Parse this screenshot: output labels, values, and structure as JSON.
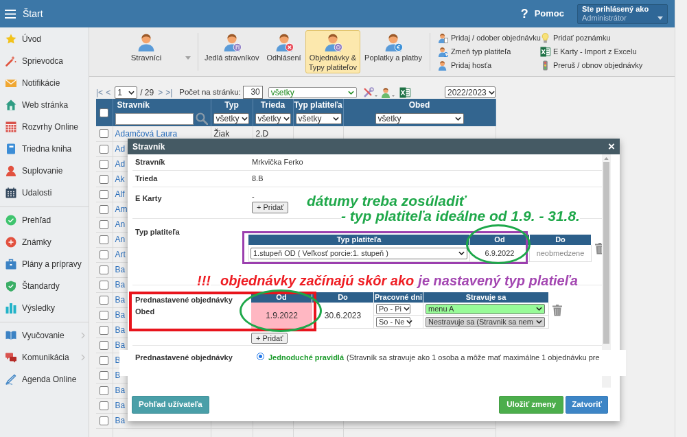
{
  "topbar": {
    "title": "Štart",
    "help_icon": "?",
    "help": "Pomoc",
    "user_label": "Ste prihlásený ako",
    "user_role": "Administrátor"
  },
  "sidebar": {
    "groups": [
      [
        {
          "label": "Úvod",
          "submenu": false
        },
        {
          "label": "Sprievodca",
          "submenu": false
        },
        {
          "label": "Notifikácie",
          "submenu": false
        },
        {
          "label": "Web stránka",
          "submenu": false
        },
        {
          "label": "Rozvrhy Online",
          "submenu": false
        },
        {
          "label": "Triedna kniha",
          "submenu": false
        },
        {
          "label": "Suplovanie",
          "submenu": false
        },
        {
          "label": "Udalosti",
          "submenu": false
        }
      ],
      [
        {
          "label": "Prehľad",
          "submenu": false
        },
        {
          "label": "Známky",
          "submenu": false
        },
        {
          "label": "Plány a prípravy",
          "submenu": false
        },
        {
          "label": "Štandardy",
          "submenu": false
        },
        {
          "label": "Výsledky",
          "submenu": false
        }
      ],
      [
        {
          "label": "Vyučovanie",
          "submenu": true
        },
        {
          "label": "Komunikácia",
          "submenu": true
        },
        {
          "label": "Agenda Online",
          "submenu": false
        }
      ]
    ]
  },
  "toolbar": {
    "menu": {
      "label": "Stravníci"
    },
    "buttons": [
      {
        "label": "Jedlá stravníkov",
        "selected": false
      },
      {
        "label": "Odhlásení",
        "selected": false
      },
      {
        "label": "Objednávky &\nTypy platiteľov",
        "selected": true
      },
      {
        "label": "Poplatky a platby",
        "selected": false
      }
    ],
    "links": [
      [
        "Pridaj / odober objednávku",
        "Zmeň typ platiteľa",
        "Pridaj hosťa"
      ],
      [
        "Pridať poznámku",
        "E Karty - Import z Excelu",
        "Preruš / obnov objednávky"
      ]
    ]
  },
  "pager": {
    "first": "|<",
    "prev": "<",
    "page": "1",
    "total": "/ 29",
    "next": ">",
    "last": ">|",
    "per_page_label": "Počet na stránku:",
    "per_page": "30",
    "filter": "všetky",
    "year": "2022/2023"
  },
  "table": {
    "select_all": {
      "checked": false
    },
    "columns": [
      "Stravník",
      "Typ",
      "Trieda",
      "Typ platiteľa",
      "Obed"
    ],
    "filters": [
      {
        "kind": "search"
      },
      {
        "kind": "select",
        "value": "všetky"
      },
      {
        "kind": "select",
        "value": "všetky"
      },
      {
        "kind": "select",
        "value": "všetky"
      },
      {
        "kind": "select",
        "value": "všetky"
      }
    ],
    "rows": [
      {
        "checked": false,
        "name": "Adamčová Laura",
        "type": "Žiak",
        "class": "2.D"
      },
      {
        "checked": false,
        "name": "Ad"
      },
      {
        "checked": false,
        "name": "Ad"
      },
      {
        "checked": false,
        "name": "Ak"
      },
      {
        "checked": false,
        "name": "Alf"
      },
      {
        "checked": false,
        "name": "Am"
      },
      {
        "checked": false,
        "name": "An"
      },
      {
        "checked": false,
        "name": "An"
      },
      {
        "checked": false,
        "name": "Art"
      },
      {
        "checked": false,
        "name": "Ba"
      },
      {
        "checked": false,
        "name": "Ba"
      },
      {
        "checked": false,
        "name": "Ba"
      },
      {
        "checked": false,
        "name": "Ba"
      },
      {
        "checked": false,
        "name": "Ba"
      },
      {
        "checked": false,
        "name": "Ba"
      },
      {
        "checked": false,
        "name": "B"
      },
      {
        "checked": false,
        "name": "B"
      },
      {
        "checked": false,
        "name": "Ba"
      },
      {
        "checked": false,
        "name": "Ba"
      },
      {
        "checked": false,
        "name": "Ba"
      }
    ]
  },
  "dialog": {
    "title": "Stravník",
    "close": "×",
    "fields": [
      {
        "label": "Stravník",
        "value": "Mrkvička Ferko"
      },
      {
        "label": "Trieda",
        "value": "8.B"
      }
    ],
    "cards": {
      "label": "E Karty",
      "value": "-",
      "button": "+ Pridať"
    },
    "payer": {
      "label": "Typ platiteľa",
      "columns": [
        "Typ platiteľa",
        "Od",
        "Do"
      ],
      "rows": [
        {
          "type": "1.stupeň OD ( Veľkosť porcie:1. stupeň )",
          "from": "6.9.2022",
          "to": "neobmedzene"
        }
      ]
    },
    "orders": {
      "label": "Prednastavené objednávky\nObed",
      "columns": [
        "Od",
        "Do",
        "Pracovné dni",
        "Stravuje sa"
      ],
      "rows": [
        {
          "from": "1.9.2022",
          "to": "30.6.2023",
          "warning": true,
          "days": [
            {
              "days": "Po - Pi",
              "meal": "menu A",
              "kind": "eating"
            },
            {
              "days": "So - Ne",
              "meal": "Nestravuje sa (Stravnik sa nem",
              "kind": "not_eating"
            }
          ]
        }
      ],
      "button": "+ Pridať"
    },
    "mode": {
      "label": "Prednastavené objednávky",
      "options": [
        {
          "label": "Jednoduché pravidlá",
          "description": "(Stravník sa stravuje ako 1 osoba a môže mať maximálne 1 objednávku pre",
          "selected": true
        }
      ]
    },
    "footer": {
      "view": "Pohľad užívateľa",
      "save": "Uložiť zmeny",
      "close": "Zatvoriť"
    }
  },
  "annotations": {
    "notes": [
      "dátumy treba zosúladiť",
      "- typ platiteľa ideálne od 1.9. - 31.8."
    ],
    "warning": [
      {
        "text": "!!!",
        "color": "#ee1d23"
      },
      {
        "text": "objednávky začínajú skôr ako",
        "color": "#ee1d23"
      },
      {
        "text": "je nastavený typ platieľa",
        "color": "#a346b1"
      }
    ]
  }
}
